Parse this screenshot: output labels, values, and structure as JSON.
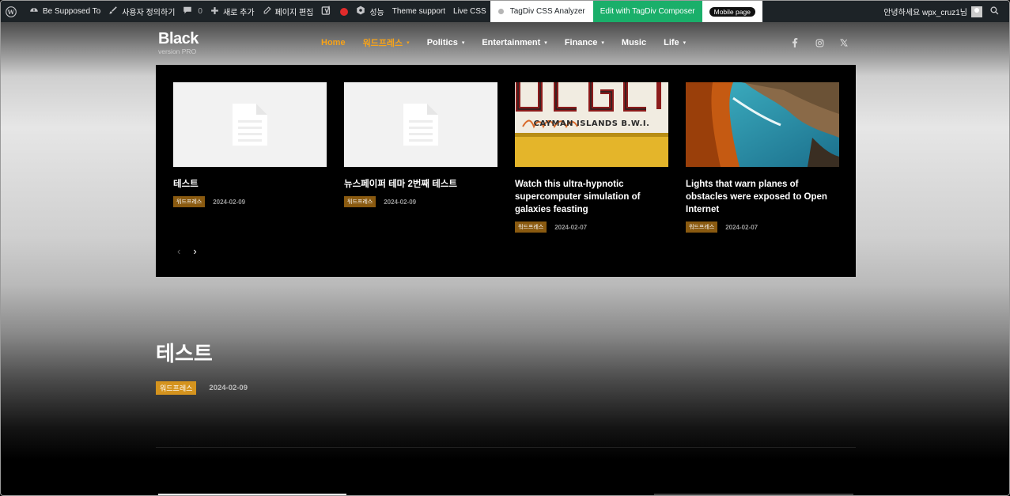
{
  "admin_bar": {
    "site_name": "Be Supposed To",
    "customize": "사용자 정의하기",
    "comments_count": "0",
    "new": "새로 추가",
    "edit_page": "페이지 편집",
    "performance": "성능",
    "theme_support": "Theme support",
    "live_css": "Live CSS",
    "css_analyzer": "TagDiv CSS Analyzer",
    "composer": "Edit with TagDiv Composer",
    "mobile_page": "Mobile page",
    "greeting": "안녕하세요 wpx_cruz1님"
  },
  "header": {
    "logo_title": "Black",
    "logo_sub": "version PRO",
    "nav": [
      {
        "label": "Home",
        "dropdown": false,
        "active": true
      },
      {
        "label": "워드프레스",
        "dropdown": true,
        "active": true
      },
      {
        "label": "Politics",
        "dropdown": true,
        "active": false
      },
      {
        "label": "Entertainment",
        "dropdown": true,
        "active": false
      },
      {
        "label": "Finance",
        "dropdown": true,
        "active": false
      },
      {
        "label": "Music",
        "dropdown": false,
        "active": false
      },
      {
        "label": "Life",
        "dropdown": true,
        "active": false
      }
    ],
    "nav_caret": "▾",
    "socials": [
      "facebook-icon",
      "instagram-icon",
      "x-icon"
    ]
  },
  "slider": {
    "cards": [
      {
        "title": "테스트",
        "category": "워드프레스",
        "date": "2024-02-09",
        "image": "placeholder"
      },
      {
        "title": "뉴스페이퍼 테마 2번째 테스트",
        "category": "워드프레스",
        "date": "2024-02-09",
        "image": "placeholder"
      },
      {
        "title": "Watch this ultra-hypnotic supercomputer simulation of galaxies feasting",
        "category": "워드프레스",
        "date": "2024-02-07",
        "image": "plate",
        "plate_text": "CAYMAN ISLANDS B.W.I."
      },
      {
        "title": "Lights that warn planes of obstacles were exposed to Open Internet",
        "category": "워드프레스",
        "date": "2024-02-07",
        "image": "coast"
      }
    ],
    "prev_icon": "‹",
    "next_icon": "›"
  },
  "post": {
    "title": "테스트",
    "category": "워드프레스",
    "date": "2024-02-09"
  },
  "colors": {
    "accent": "#f7a319",
    "composer_green": "#1aaf6a",
    "badge_dark": "#8a5a10",
    "badge_post": "#d4931e"
  }
}
